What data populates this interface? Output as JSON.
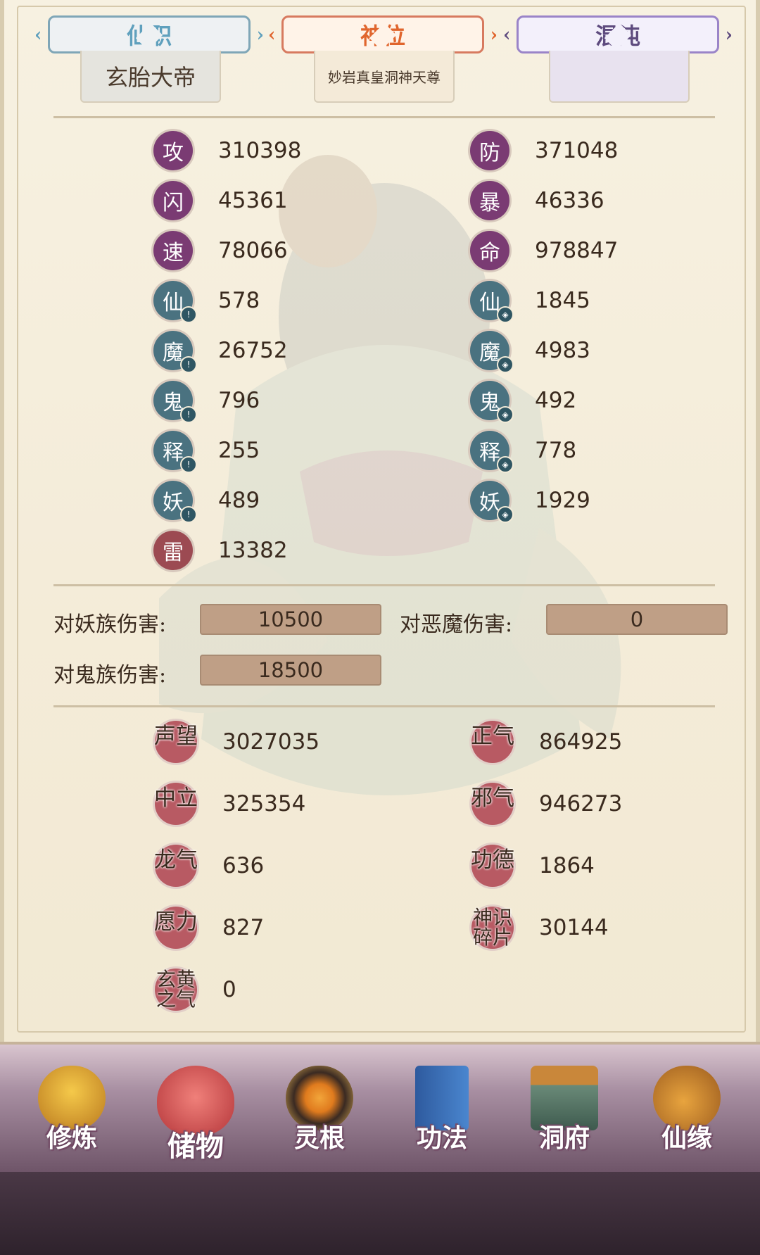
{
  "tabs": {
    "xianzhi": {
      "label": "仙职",
      "sub": "玄胎大帝"
    },
    "shenwei": {
      "label": "神位",
      "sub": "妙岩真皇洞神天尊"
    },
    "hundun": {
      "label": "混沌",
      "sub": ""
    }
  },
  "stats_left": [
    {
      "icon": "攻",
      "value": "310398",
      "kind": "purple"
    },
    {
      "icon": "闪",
      "value": "45361",
      "kind": "purple"
    },
    {
      "icon": "速",
      "value": "78066",
      "kind": "purple"
    },
    {
      "icon": "仙",
      "value": "578",
      "kind": "teal"
    },
    {
      "icon": "魔",
      "value": "26752",
      "kind": "teal"
    },
    {
      "icon": "鬼",
      "value": "796",
      "kind": "teal"
    },
    {
      "icon": "释",
      "value": "255",
      "kind": "teal"
    },
    {
      "icon": "妖",
      "value": "489",
      "kind": "teal"
    },
    {
      "icon": "雷",
      "value": "13382",
      "kind": "thunder"
    }
  ],
  "stats_right": [
    {
      "icon": "防",
      "value": "371048",
      "kind": "purple"
    },
    {
      "icon": "暴",
      "value": "46336",
      "kind": "purple"
    },
    {
      "icon": "命",
      "value": "978847",
      "kind": "purple"
    },
    {
      "icon": "仙",
      "value": "1845",
      "kind": "teal"
    },
    {
      "icon": "魔",
      "value": "4983",
      "kind": "teal"
    },
    {
      "icon": "鬼",
      "value": "492",
      "kind": "teal"
    },
    {
      "icon": "释",
      "value": "778",
      "kind": "teal"
    },
    {
      "icon": "妖",
      "value": "1929",
      "kind": "teal"
    }
  ],
  "damage": {
    "yao_label": "对妖族伤害:",
    "yao_value": "10500",
    "emo_label": "对恶魔伤害:",
    "emo_value": "0",
    "gui_label": "对鬼族伤害:",
    "gui_value": "18500"
  },
  "reputation": {
    "shengwang": {
      "label": "声望",
      "value": "3027035"
    },
    "zhengqi": {
      "label": "正气",
      "value": "864925"
    },
    "zhongli": {
      "label": "中立",
      "value": "325354"
    },
    "xieqi": {
      "label": "邪气",
      "value": "946273"
    },
    "longqi": {
      "label": "龙气",
      "value": "636"
    },
    "gongde": {
      "label": "功德",
      "value": "1864"
    },
    "yuanli": {
      "label": "愿力",
      "value": "827"
    },
    "shenshi": {
      "label": "神识碎片",
      "value": "30144"
    },
    "xuanhuang": {
      "label": "玄黄之气",
      "value": "0"
    }
  },
  "nav": {
    "xiulian": "修炼",
    "chuwu": "储物",
    "linggen": "灵根",
    "gongfa": "功法",
    "dongfu": "洞府",
    "xianyuan": "仙缘"
  },
  "colors": {
    "purple_icon": "#7a3b73",
    "teal_icon": "#4a7280",
    "rep_icon": "#b85a63",
    "damage_box": "#bf9f86"
  }
}
